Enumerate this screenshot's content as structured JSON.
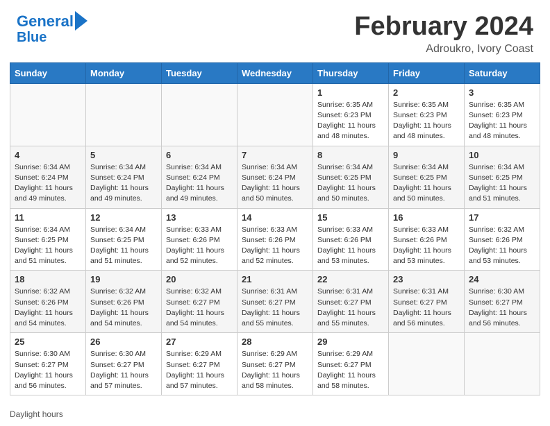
{
  "header": {
    "logo_text1": "General",
    "logo_text2": "Blue",
    "main_title": "February 2024",
    "subtitle": "Adroukro, Ivory Coast"
  },
  "calendar": {
    "days_of_week": [
      "Sunday",
      "Monday",
      "Tuesday",
      "Wednesday",
      "Thursday",
      "Friday",
      "Saturday"
    ],
    "weeks": [
      [
        {
          "day": "",
          "info": ""
        },
        {
          "day": "",
          "info": ""
        },
        {
          "day": "",
          "info": ""
        },
        {
          "day": "",
          "info": ""
        },
        {
          "day": "1",
          "info": "Sunrise: 6:35 AM\nSunset: 6:23 PM\nDaylight: 11 hours and 48 minutes."
        },
        {
          "day": "2",
          "info": "Sunrise: 6:35 AM\nSunset: 6:23 PM\nDaylight: 11 hours and 48 minutes."
        },
        {
          "day": "3",
          "info": "Sunrise: 6:35 AM\nSunset: 6:23 PM\nDaylight: 11 hours and 48 minutes."
        }
      ],
      [
        {
          "day": "4",
          "info": "Sunrise: 6:34 AM\nSunset: 6:24 PM\nDaylight: 11 hours and 49 minutes."
        },
        {
          "day": "5",
          "info": "Sunrise: 6:34 AM\nSunset: 6:24 PM\nDaylight: 11 hours and 49 minutes."
        },
        {
          "day": "6",
          "info": "Sunrise: 6:34 AM\nSunset: 6:24 PM\nDaylight: 11 hours and 49 minutes."
        },
        {
          "day": "7",
          "info": "Sunrise: 6:34 AM\nSunset: 6:24 PM\nDaylight: 11 hours and 50 minutes."
        },
        {
          "day": "8",
          "info": "Sunrise: 6:34 AM\nSunset: 6:25 PM\nDaylight: 11 hours and 50 minutes."
        },
        {
          "day": "9",
          "info": "Sunrise: 6:34 AM\nSunset: 6:25 PM\nDaylight: 11 hours and 50 minutes."
        },
        {
          "day": "10",
          "info": "Sunrise: 6:34 AM\nSunset: 6:25 PM\nDaylight: 11 hours and 51 minutes."
        }
      ],
      [
        {
          "day": "11",
          "info": "Sunrise: 6:34 AM\nSunset: 6:25 PM\nDaylight: 11 hours and 51 minutes."
        },
        {
          "day": "12",
          "info": "Sunrise: 6:34 AM\nSunset: 6:25 PM\nDaylight: 11 hours and 51 minutes."
        },
        {
          "day": "13",
          "info": "Sunrise: 6:33 AM\nSunset: 6:26 PM\nDaylight: 11 hours and 52 minutes."
        },
        {
          "day": "14",
          "info": "Sunrise: 6:33 AM\nSunset: 6:26 PM\nDaylight: 11 hours and 52 minutes."
        },
        {
          "day": "15",
          "info": "Sunrise: 6:33 AM\nSunset: 6:26 PM\nDaylight: 11 hours and 53 minutes."
        },
        {
          "day": "16",
          "info": "Sunrise: 6:33 AM\nSunset: 6:26 PM\nDaylight: 11 hours and 53 minutes."
        },
        {
          "day": "17",
          "info": "Sunrise: 6:32 AM\nSunset: 6:26 PM\nDaylight: 11 hours and 53 minutes."
        }
      ],
      [
        {
          "day": "18",
          "info": "Sunrise: 6:32 AM\nSunset: 6:26 PM\nDaylight: 11 hours and 54 minutes."
        },
        {
          "day": "19",
          "info": "Sunrise: 6:32 AM\nSunset: 6:26 PM\nDaylight: 11 hours and 54 minutes."
        },
        {
          "day": "20",
          "info": "Sunrise: 6:32 AM\nSunset: 6:27 PM\nDaylight: 11 hours and 54 minutes."
        },
        {
          "day": "21",
          "info": "Sunrise: 6:31 AM\nSunset: 6:27 PM\nDaylight: 11 hours and 55 minutes."
        },
        {
          "day": "22",
          "info": "Sunrise: 6:31 AM\nSunset: 6:27 PM\nDaylight: 11 hours and 55 minutes."
        },
        {
          "day": "23",
          "info": "Sunrise: 6:31 AM\nSunset: 6:27 PM\nDaylight: 11 hours and 56 minutes."
        },
        {
          "day": "24",
          "info": "Sunrise: 6:30 AM\nSunset: 6:27 PM\nDaylight: 11 hours and 56 minutes."
        }
      ],
      [
        {
          "day": "25",
          "info": "Sunrise: 6:30 AM\nSunset: 6:27 PM\nDaylight: 11 hours and 56 minutes."
        },
        {
          "day": "26",
          "info": "Sunrise: 6:30 AM\nSunset: 6:27 PM\nDaylight: 11 hours and 57 minutes."
        },
        {
          "day": "27",
          "info": "Sunrise: 6:29 AM\nSunset: 6:27 PM\nDaylight: 11 hours and 57 minutes."
        },
        {
          "day": "28",
          "info": "Sunrise: 6:29 AM\nSunset: 6:27 PM\nDaylight: 11 hours and 58 minutes."
        },
        {
          "day": "29",
          "info": "Sunrise: 6:29 AM\nSunset: 6:27 PM\nDaylight: 11 hours and 58 minutes."
        },
        {
          "day": "",
          "info": ""
        },
        {
          "day": "",
          "info": ""
        }
      ]
    ]
  },
  "footer": {
    "note": "Daylight hours"
  }
}
